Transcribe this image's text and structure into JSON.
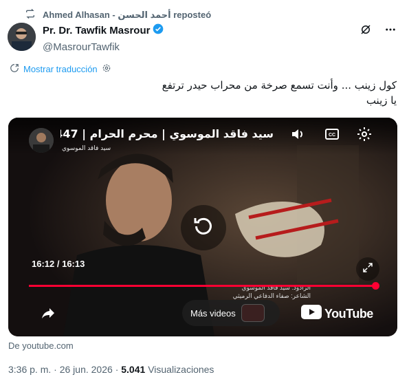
{
  "repost": {
    "text": "Ahmed Alhasan - أحمد الحسن reposteó",
    "icon": "repost-icon"
  },
  "author": {
    "name": "Pr. Dr. Tawfik Masrour",
    "handle": "@MasrourTawfik",
    "verified_icon": "verified-badge-icon"
  },
  "translate": {
    "label": "Mostrar traducción"
  },
  "tweet": {
    "line1": "كول زينب ... وأنت تسمع صرخة من محراب حيدر ترتفع",
    "line2": "يا زينب"
  },
  "video": {
    "title": "سيد فاقد الموسوي | محرم الحرام | 1447هـ",
    "channel": "سيد فاقد الموسوي",
    "time": "16:12 / 16:13",
    "progress": 0.999,
    "more_videos": "Más videos",
    "brand": "YouTube"
  },
  "source": "De youtube.com",
  "meta": {
    "time": "3:36 p. m.",
    "sep1": "·",
    "date": "26 jun. 2026",
    "sep2": "·",
    "views": "5.041",
    "views_label": "Visualizaciones"
  },
  "colors": {
    "accent": "#1d9bf0",
    "secondary": "#536471",
    "progress": "#ff0033"
  }
}
